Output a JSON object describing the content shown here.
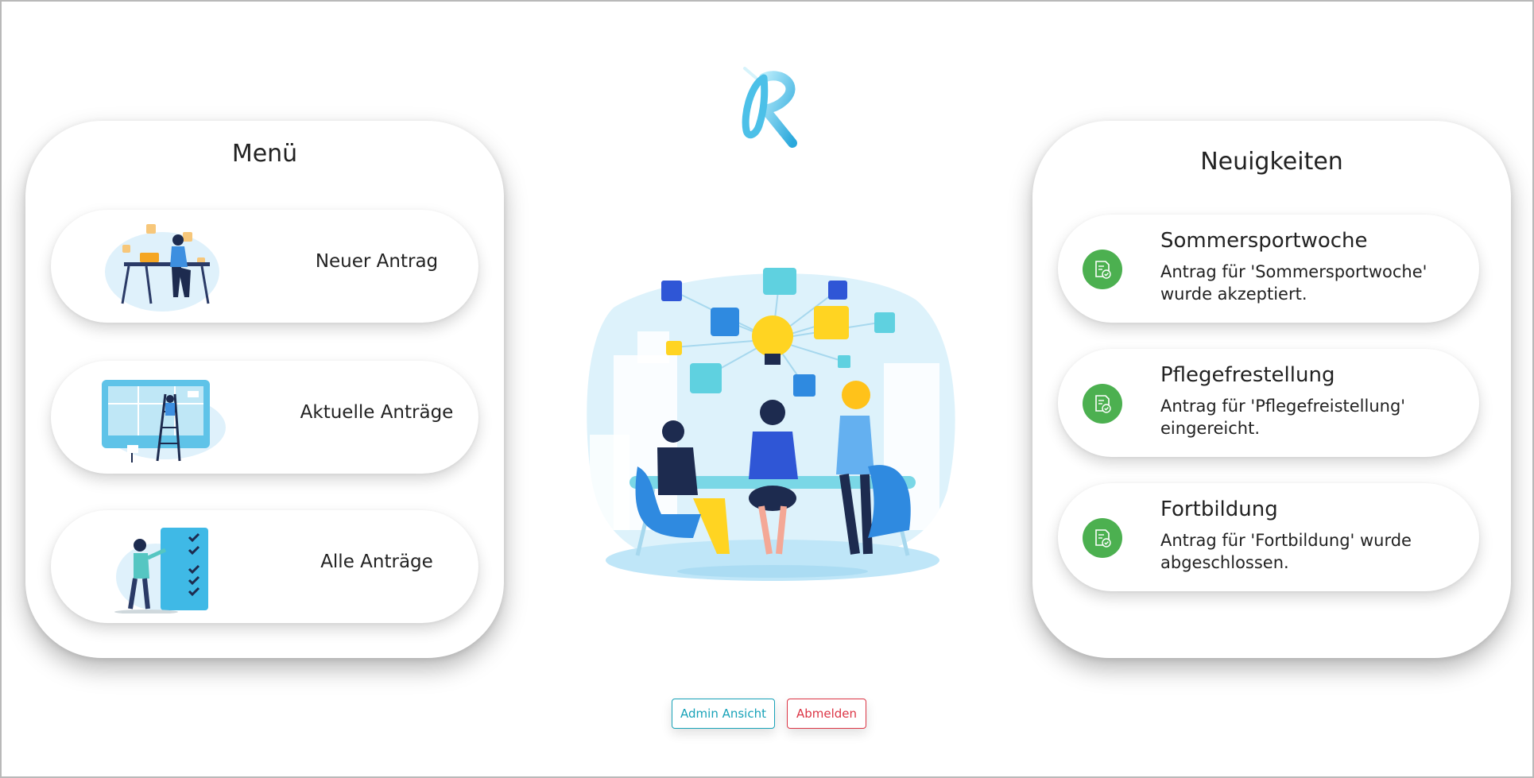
{
  "colors": {
    "accent_teal": "#17a2b8",
    "accent_red": "#dc3545",
    "status_green": "#4cb050"
  },
  "menu": {
    "title": "Menü",
    "items": [
      {
        "label": "Neuer Antrag",
        "illustration": "person-at-desk-laptop"
      },
      {
        "label": "Aktuelle Anträge",
        "illustration": "person-on-ladder-board"
      },
      {
        "label": "Alle Anträge",
        "illustration": "person-checklist"
      }
    ]
  },
  "news": {
    "title": "Neuigkeiten",
    "items": [
      {
        "title": "Sommersportwoche",
        "text": "Antrag für 'Sommersportwoche' wurde akzeptiert.",
        "icon": "document-check-icon"
      },
      {
        "title": "Pflegefrestellung",
        "text": "Antrag für 'Pflegefreistellung' eingereicht.",
        "icon": "document-check-icon"
      },
      {
        "title": "Fortbildung",
        "text": "Antrag für 'Fortbildung' wurde abgeschlossen.",
        "icon": "document-check-icon"
      }
    ]
  },
  "buttons": {
    "admin_label": "Admin Ansicht",
    "logout_label": "Abmelden"
  }
}
